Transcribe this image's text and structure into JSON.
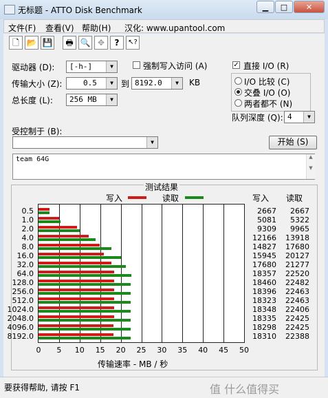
{
  "window": {
    "title": "无标题 - ATTO Disk Benchmark"
  },
  "menu": [
    "文件(F)",
    "查看(V)",
    "帮助(H)",
    "汉化: www.upantool.com"
  ],
  "toolbar": {
    "icons": [
      "new-icon",
      "open-icon",
      "save-icon",
      "print-icon",
      "print-preview-icon",
      "move-icon",
      "help-icon",
      "context-help-icon"
    ],
    "glyphs": [
      "🗋",
      "📂",
      "💾",
      "🖶",
      "🔍",
      "✥",
      "?",
      "↖?"
    ]
  },
  "form": {
    "drive_label": "驱动器 (D):",
    "drive_value": "[-h-]",
    "transfer_label": "传输大小 (Z):",
    "transfer_from": "0.5",
    "to_label": "到",
    "transfer_to": "8192.0",
    "unit": "KB",
    "length_label": "总长度 (L):",
    "length_value": "256 MB",
    "force_write_label": "强制写入访问 (A)",
    "direct_io_label": "直接 I/O (R)",
    "direct_io_checked": "✓",
    "io_compare_label": "I/O 比较 (C)",
    "overlapped_label": "交叠 I/O (O)",
    "neither_label": "两者都不 (N)",
    "queue_label": "队列深度 (Q):",
    "queue_value": "4",
    "controlled_label": "受控制于 (B):",
    "controlled_value": "",
    "start_label": "开始 (S)",
    "description": "team 64G"
  },
  "results": {
    "title": "测试结果",
    "write_legend": "写入",
    "read_legend": "读取",
    "write_header": "写入",
    "read_header": "读取",
    "xlabel": "传输速率 - MB / 秒",
    "write_color": "#d11a1a",
    "read_color": "#1a8a1a"
  },
  "chart_data": {
    "type": "bar",
    "title": "测试结果",
    "xlabel": "传输速率 - MB / 秒",
    "xlim": [
      0,
      50
    ],
    "x_ticks": [
      "0",
      "5",
      "10",
      "15",
      "20",
      "25",
      "30",
      "35",
      "40",
      "45",
      "50"
    ],
    "categories": [
      "0.5",
      "1.0",
      "2.0",
      "4.0",
      "8.0",
      "16.0",
      "32.0",
      "64.0",
      "128.0",
      "256.0",
      "512.0",
      "1024.0",
      "2048.0",
      "4096.0",
      "8192.0"
    ],
    "series": [
      {
        "name": "写入",
        "values": [
          2.667,
          5.081,
          9.309,
          12.166,
          14.827,
          15.945,
          17.68,
          18.357,
          18.46,
          18.396,
          18.323,
          18.348,
          18.335,
          18.298,
          18.31
        ]
      },
      {
        "name": "读取",
        "values": [
          2.667,
          5.322,
          9.965,
          13.918,
          17.68,
          20.127,
          21.277,
          22.52,
          22.482,
          22.463,
          22.463,
          22.406,
          22.425,
          22.425,
          22.388
        ]
      }
    ],
    "write_kb": [
      "2667",
      "5081",
      "9309",
      "12166",
      "14827",
      "15945",
      "17680",
      "18357",
      "18460",
      "18396",
      "18323",
      "18348",
      "18335",
      "18298",
      "18310"
    ],
    "read_kb": [
      "2667",
      "5322",
      "9965",
      "13918",
      "17680",
      "20127",
      "21277",
      "22520",
      "22482",
      "22463",
      "22463",
      "22406",
      "22425",
      "22425",
      "22388"
    ]
  },
  "status": {
    "text": "要获得帮助, 请按 F1",
    "watermark": "值 什么值得买"
  }
}
